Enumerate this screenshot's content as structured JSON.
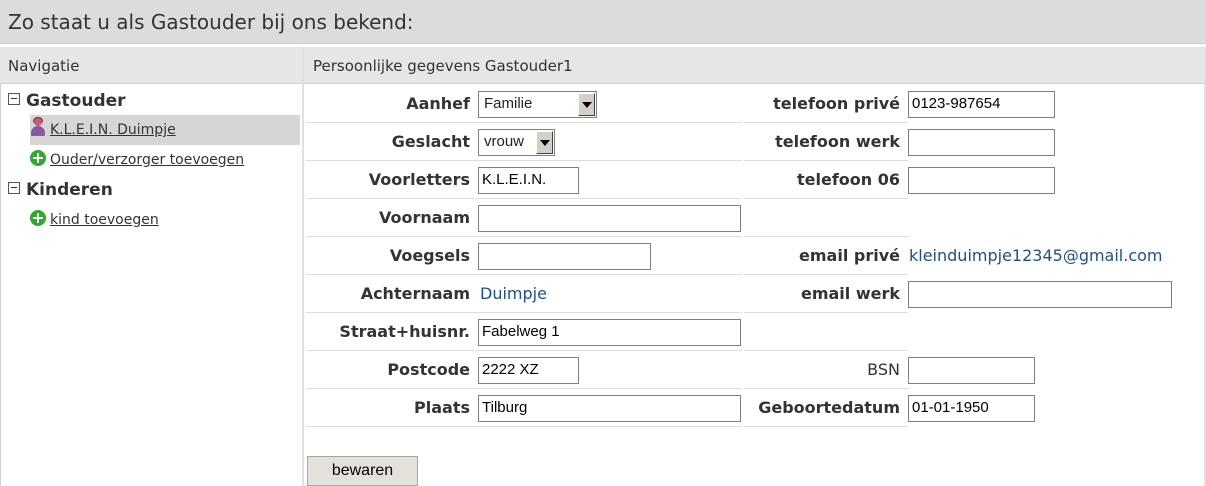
{
  "page_title": "Zo staat u als Gastouder bij ons bekend:",
  "nav": {
    "heading": "Navigatie",
    "group_gastouder": "Gastouder",
    "item_person": "K.L.E.I.N. Duimpje",
    "item_add_parent": "Ouder/verzorger toevoegen",
    "group_kinderen": "Kinderen",
    "item_add_child": "kind toevoegen"
  },
  "content": {
    "heading": "Persoonlijke gegevens Gastouder1"
  },
  "form": {
    "aanhef_label": "Aanhef",
    "aanhef_value": "Familie",
    "geslacht_label": "Geslacht",
    "geslacht_value": "vrouw",
    "voorletters_label": "Voorletters",
    "voorletters_value": "K.L.E.I.N.",
    "voornaam_label": "Voornaam",
    "voornaam_value": "",
    "voegsels_label": "Voegsels",
    "voegsels_value": "",
    "achternaam_label": "Achternaam",
    "achternaam_value": "Duimpje",
    "straat_label": "Straat+huisnr.",
    "straat_value": "Fabelweg 1",
    "postcode_label": "Postcode",
    "postcode_value": "2222 XZ",
    "plaats_label": "Plaats",
    "plaats_value": "Tilburg",
    "tel_prive_label": "telefoon privé",
    "tel_prive_value": "0123-987654",
    "tel_werk_label": "telefoon werk",
    "tel_werk_value": "",
    "tel_06_label": "telefoon 06",
    "tel_06_value": "",
    "email_prive_label": "email privé",
    "email_prive_value": "kleinduimpje12345@gmail.com",
    "email_werk_label": "email werk",
    "email_werk_value": "",
    "bsn_label": "BSN",
    "bsn_value": "",
    "geboortedatum_label": "Geboortedatum",
    "geboortedatum_value": "01-01-1950",
    "save_label": "bewaren"
  }
}
